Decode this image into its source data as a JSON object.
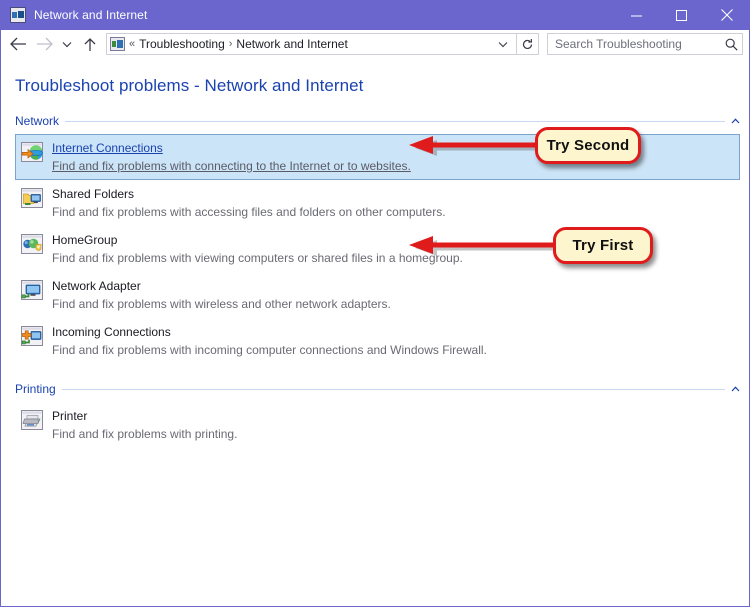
{
  "window": {
    "title": "Network and Internet",
    "title_icon": "network-internet-icon",
    "controls": {
      "minimize": "minimize-icon",
      "maximize": "maximize-icon",
      "close": "close-icon"
    }
  },
  "toolbar": {
    "back": "back-arrow-icon",
    "forward": "forward-arrow-icon",
    "recent": "chevron-down-icon",
    "up": "up-arrow-icon",
    "refresh": "refresh-icon",
    "breadcrumb": {
      "icon": "control-panel-icon",
      "prefix": "«",
      "items": [
        "Troubleshooting",
        "Network and Internet"
      ],
      "separator": "›",
      "dropdown": "chevron-down-icon"
    },
    "search": {
      "placeholder": "Search Troubleshooting",
      "icon": "search-icon"
    }
  },
  "page": {
    "title": "Troubleshoot problems - Network and Internet"
  },
  "sections": [
    {
      "title": "Network",
      "collapse_icon": "chevron-up-icon",
      "items": [
        {
          "icon": "internet-connections-icon",
          "title": "Internet Connections",
          "description": "Find and fix problems with connecting to the Internet or to websites.",
          "selected": true
        },
        {
          "icon": "shared-folders-icon",
          "title": "Shared Folders",
          "description": "Find and fix problems with accessing files and folders on other computers.",
          "selected": false
        },
        {
          "icon": "homegroup-icon",
          "title": "HomeGroup",
          "description": "Find and fix problems with viewing computers or shared files in a homegroup.",
          "selected": false
        },
        {
          "icon": "network-adapter-icon",
          "title": "Network Adapter",
          "description": "Find and fix problems with wireless and other network adapters.",
          "selected": false
        },
        {
          "icon": "incoming-connections-icon",
          "title": "Incoming Connections",
          "description": "Find and fix problems with incoming computer connections and Windows Firewall.",
          "selected": false
        }
      ]
    },
    {
      "title": "Printing",
      "collapse_icon": "chevron-up-icon",
      "items": [
        {
          "icon": "printer-icon",
          "title": "Printer",
          "description": "Find and fix problems with printing.",
          "selected": false
        }
      ]
    }
  ],
  "annotations": [
    {
      "label": "Try Second",
      "target": "internet-connections-row"
    },
    {
      "label": "Try First",
      "target": "network-adapter-row"
    }
  ],
  "colors": {
    "titlebar": "#6A66CE",
    "heading": "#1b43b0",
    "selection": "#cce4f7",
    "annotation_border": "#e01b1b",
    "annotation_fill": "#fcf5cd"
  }
}
